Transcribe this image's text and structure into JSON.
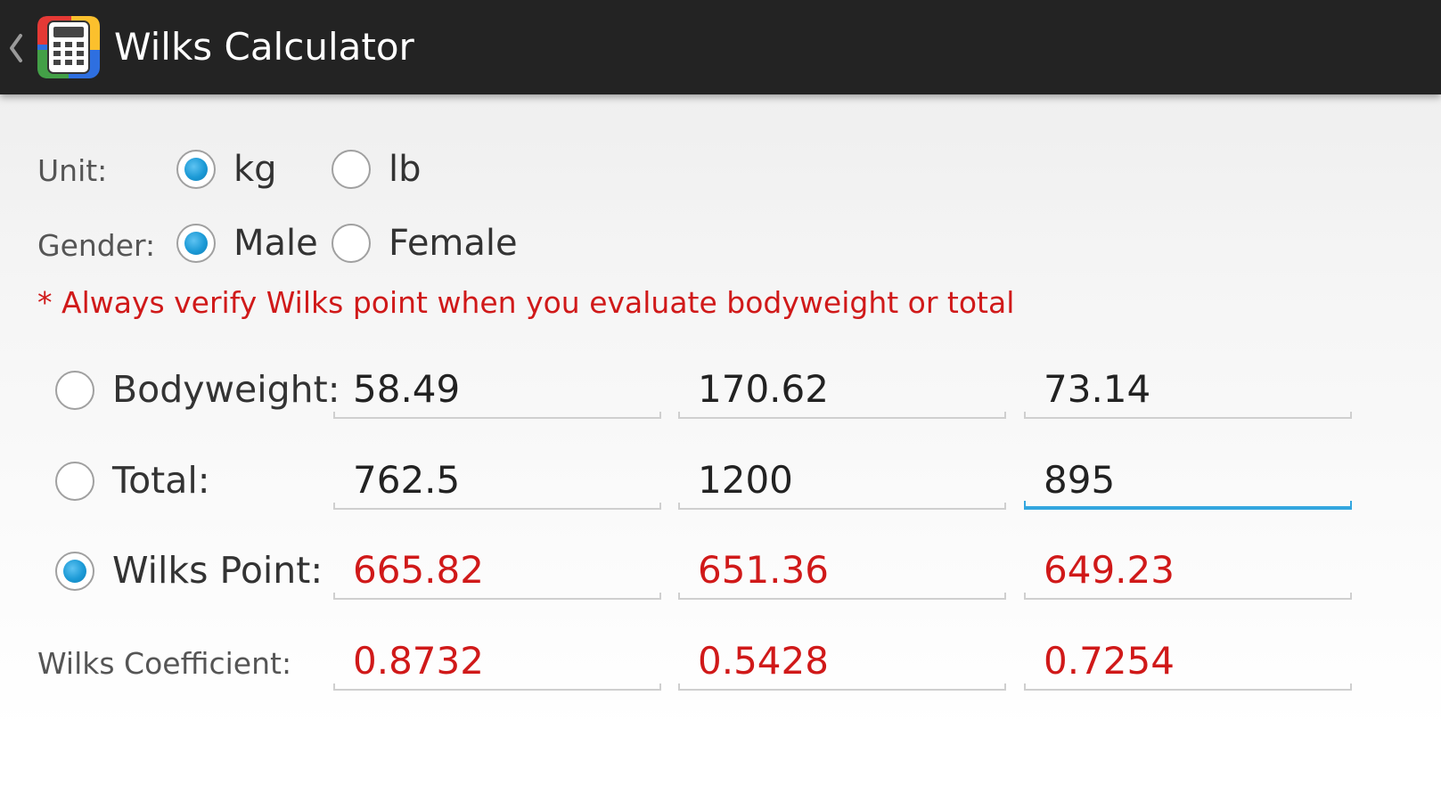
{
  "app": {
    "title": "Wilks Calculator"
  },
  "unit": {
    "label": "Unit:",
    "options": [
      "kg",
      "lb"
    ],
    "selected": "kg"
  },
  "gender": {
    "label": "Gender:",
    "options": [
      "Male",
      "Female"
    ],
    "selected": "Male"
  },
  "warning": "* Always verify Wilks point when you evaluate bodyweight or total",
  "rows": {
    "bodyweight": {
      "label": "Bodyweight:",
      "values": [
        "58.49",
        "170.62",
        "73.14"
      ]
    },
    "total": {
      "label": "Total:",
      "values": [
        "762.5",
        "1200",
        "895"
      ]
    },
    "wilks_point": {
      "label": "Wilks Point:",
      "values": [
        "665.82",
        "651.36",
        "649.23"
      ]
    },
    "wilks_coefficient": {
      "label": "Wilks Coefficient:",
      "values": [
        "0.8732",
        "0.5428",
        "0.7254"
      ]
    }
  },
  "solve_for": "wilks_point",
  "colors": {
    "actionbar": "#232323",
    "accent": "#33a6df",
    "result_text": "#d01919"
  },
  "icons": {
    "back": "chevron-left-icon",
    "app": "calculator-icon"
  }
}
